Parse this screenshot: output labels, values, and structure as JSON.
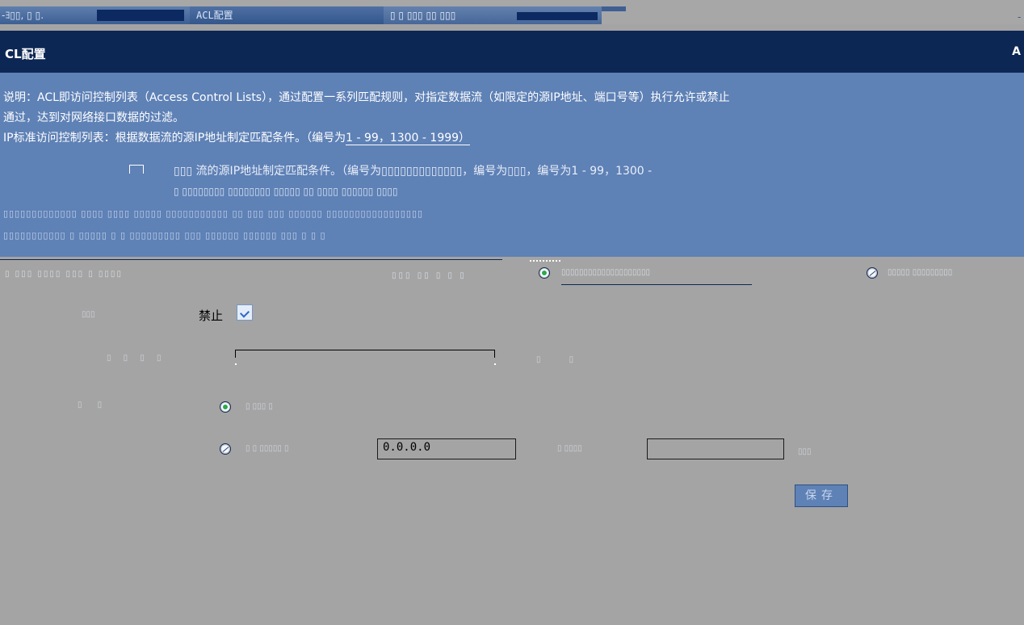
{
  "tabs": {
    "left_text": "-ﾖ▯▯, ▯ ▯.",
    "active_label": "ACL配置",
    "third_label": "▯ ▯ ▯▯▯ ▯▯ ▯▯▯",
    "edge": "-"
  },
  "header": {
    "title": "CL配置",
    "edge": "A"
  },
  "description": {
    "line1": "说明：ACL即访问控制列表（Access Control Lists），通过配置一系列匹配规则，对指定数据流（如限定的源IP地址、端口号等）执行允许或禁止",
    "line2": "通过，达到对网络接口数据的过滤。",
    "line3_prefix": "IP标准访问控制列表：根据数据流的源IP地址制定匹配条件。（编号为",
    "line3_suffix": "1 - 99，1300 - 1999）",
    "line4": "▯▯▯ 流的源IP地址制定匹配条件。（编号为▯▯▯▯▯▯▯▯▯▯▯▯▯，编号为▯▯▯，编号为1 - 99，1300 -",
    "line5": "▯ ▯▯▯▯▯▯▯▯ ▯▯▯▯▯▯▯▯ ▯▯▯▯▯ ▯▯ ▯▯▯▯ ▯▯▯▯▯▯ ▯▯▯▯",
    "line6": "▯▯▯▯▯▯▯▯▯▯▯▯▯ ▯▯▯▯ ▯▯▯▯ ▯▯▯▯▯ ▯▯▯▯▯▯▯▯▯▯▯ ▯▯ ▯▯▯ ▯▯▯ ▯▯▯▯▯▯ ▯▯▯▯▯▯▯▯▯▯▯▯▯▯▯▯▯",
    "line7": "▯▯▯▯▯▯▯▯▯▯▯ ▯ ▯▯▯▯▯ ▯ ▯ ▯▯▯▯▯▯▯▯▯ ▯▯▯ ▯▯▯▯▯▯ ▯▯▯▯▯▯ ▯▯▯ ▯ ▯ ▯"
  },
  "rule_type": {
    "left_text": "▯ ▯▯▯ ▯▯▯▯ ▯▯▯ ▯ ▯▯▯▯",
    "mid_text": "▯▯▯ ▯▯ ▯ ▯ ▯",
    "option_standard_label": "▯▯▯▯▯▯▯▯▯▯▯▯▯▯▯▯▯▯▯▯",
    "option_extended_label": "▯▯▯▯▯ ▯▯▯▯▯▯▯▯▯"
  },
  "form": {
    "action_label": "▯▯▯",
    "action_value": "禁止",
    "acl_label": "▯ ▯ ▯ ▯",
    "acl_hint": "▯ ▯",
    "source_label": "▯ ▯",
    "source_any_label": "▯ ▯▯▯ ▯",
    "source_specify_label": "▯ ▯ ▯▯▯▯▯ ▯",
    "source_ip_value": "0.0.0.0",
    "mask_label": "▯ ▯▯▯▯",
    "mask_value": "",
    "mask_suffix": "▯▯▯",
    "save_label": "保存"
  }
}
